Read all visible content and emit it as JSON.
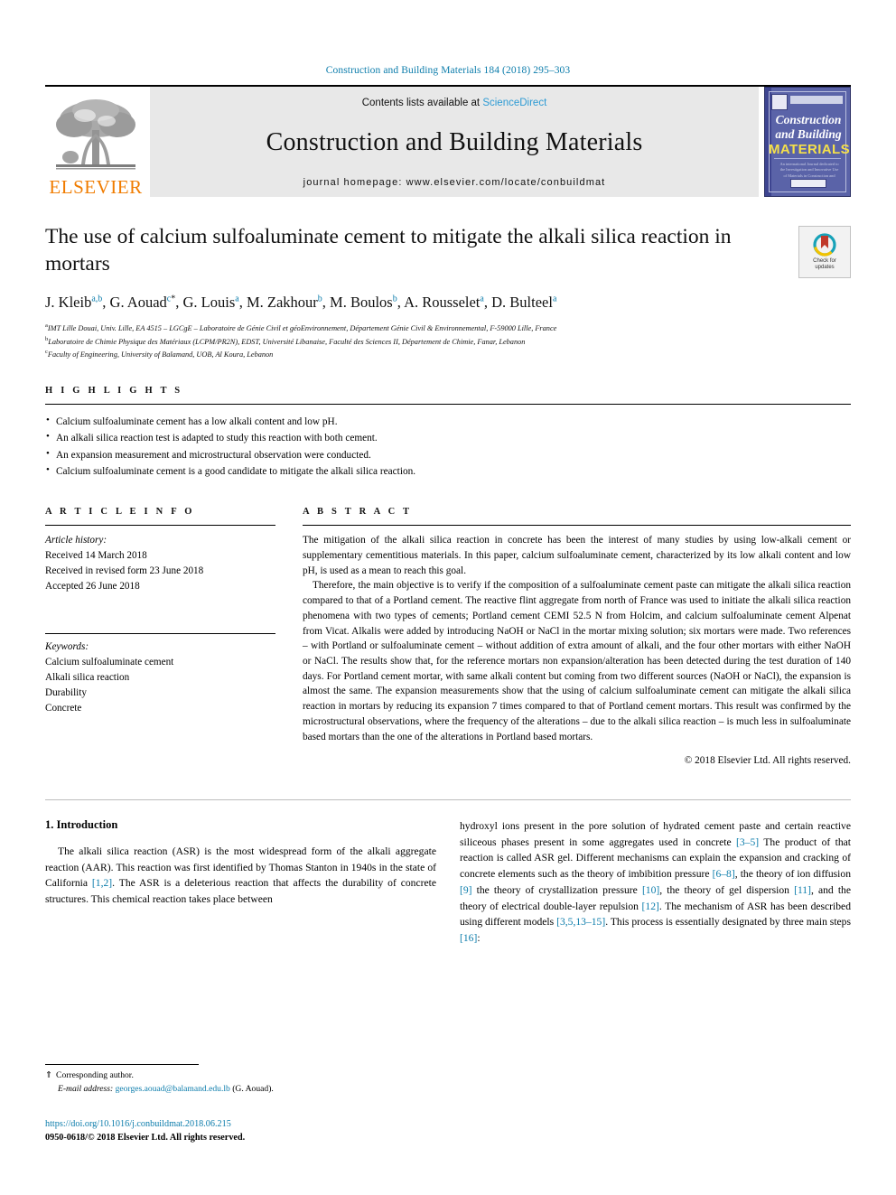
{
  "running_head": "Construction and Building Materials 184 (2018) 295–303",
  "masthead": {
    "publisher_name": "ELSEVIER",
    "contents_prefix": "Contents lists available at ",
    "contents_link": "ScienceDirect",
    "journal_title": "Construction and Building Materials",
    "homepage_line": "journal homepage: www.elsevier.com/locate/conbuildmat",
    "cover": {
      "line1": "Construction",
      "line2": "and Building",
      "line3": "MATERIALS",
      "blurb": "An international Journal dedicated to the Investigation and Innovative Use of Materials in Construction and Repair"
    }
  },
  "article": {
    "title": "The use of calcium sulfoaluminate cement to mitigate the alkali silica reaction in mortars",
    "crossmark_line1": "Check for",
    "crossmark_line2": "updates",
    "authors": [
      {
        "name": "J. Kleib",
        "sup": "a,b",
        "star": false
      },
      {
        "name": "G. Aouad",
        "sup": "c",
        "star": true
      },
      {
        "name": "G. Louis",
        "sup": "a",
        "star": false
      },
      {
        "name": "M. Zakhour",
        "sup": "b",
        "star": false
      },
      {
        "name": "M. Boulos",
        "sup": "b",
        "star": false
      },
      {
        "name": "A. Rousselet",
        "sup": "a",
        "star": false
      },
      {
        "name": "D. Bulteel",
        "sup": "a",
        "star": false
      }
    ],
    "affiliations": [
      {
        "marker": "a",
        "text": "IMT Lille Douai, Univ. Lille, EA 4515 – LGCgE – Laboratoire de Génie Civil et géoEnvironnement, Département Génie Civil & Environnemental, F-59000 Lille, France"
      },
      {
        "marker": "b",
        "text": "Laboratoire de Chimie Physique des Matériaux (LCPM/PR2N), EDST, Université Libanaise, Faculté des Sciences II, Département de Chimie, Fanar, Lebanon"
      },
      {
        "marker": "c",
        "text": "Faculty of Engineering, University of Balamand, UOB, Al Koura, Lebanon"
      }
    ]
  },
  "highlights": {
    "heading": "H I G H L I G H T S",
    "items": [
      "Calcium sulfoaluminate cement has a low alkali content and low pH.",
      "An alkali silica reaction test is adapted to study this reaction with both cement.",
      "An expansion measurement and microstructural observation were conducted.",
      "Calcium sulfoaluminate cement is a good candidate to mitigate the alkali silica reaction."
    ]
  },
  "article_info": {
    "heading": "A R T I C L E   I N F O",
    "history_label": "Article history:",
    "history": [
      "Received 14 March 2018",
      "Received in revised form 23 June 2018",
      "Accepted 26 June 2018"
    ],
    "keywords_label": "Keywords:",
    "keywords": [
      "Calcium sulfoaluminate cement",
      "Alkali silica reaction",
      "Durability",
      "Concrete"
    ]
  },
  "abstract": {
    "heading": "A B S T R A C T",
    "paragraph1": "The mitigation of the alkali silica reaction in concrete has been the interest of many studies by using low-alkali cement or supplementary cementitious materials. In this paper, calcium sulfoaluminate cement, characterized by its low alkali content and low pH, is used as a mean to reach this goal.",
    "paragraph2": "Therefore, the main objective is to verify if the composition of a sulfoaluminate cement paste can mitigate the alkali silica reaction compared to that of a Portland cement. The reactive flint aggregate from north of France was used to initiate the alkali silica reaction phenomena with two types of cements; Portland cement CEMI 52.5 N from Holcim, and calcium sulfoaluminate cement Alpenat from Vicat. Alkalis were added by introducing NaOH or NaCl in the mortar mixing solution; six mortars were made. Two references – with Portland or sulfoaluminate cement – without addition of extra amount of alkali, and the four other mortars with either NaOH or NaCl. The results show that, for the reference mortars non expansion/alteration has been detected during the test duration of 140 days. For Portland cement mortar, with same alkali content but coming from two different sources (NaOH or NaCl), the expansion is almost the same. The expansion measurements show that the using of calcium sulfoaluminate cement can mitigate the alkali silica reaction in mortars by reducing its expansion 7 times compared to that of Portland cement mortars. This result was confirmed by the microstructural observations, where the frequency of the alterations – due to the alkali silica reaction – is much less in sulfoaluminate based mortars than the one of the alterations in Portland based mortars.",
    "copyright": "© 2018 Elsevier Ltd. All rights reserved."
  },
  "introduction": {
    "number_title": "1. Introduction",
    "left_segments": [
      {
        "t": "The alkali silica reaction (ASR) is the most widespread form of the alkali aggregate reaction (AAR). This reaction was first identified by Thomas Stanton in 1940s in the state of California ",
        "ref": false
      },
      {
        "t": "[1,2]",
        "ref": true
      },
      {
        "t": ". The ASR is a deleterious reaction that affects the durability of concrete structures. This chemical reaction takes place between",
        "ref": false
      }
    ],
    "right_segments": [
      {
        "t": "hydroxyl ions present in the pore solution of hydrated cement paste and certain reactive siliceous phases present in some aggregates used in concrete ",
        "ref": false
      },
      {
        "t": "[3–5]",
        "ref": true
      },
      {
        "t": " The product of that reaction is called ASR gel. Different mechanisms can explain the expansion and cracking of concrete elements such as the theory of imbibition pressure ",
        "ref": false
      },
      {
        "t": "[6–8]",
        "ref": true
      },
      {
        "t": ", the theory of ion diffusion ",
        "ref": false
      },
      {
        "t": "[9]",
        "ref": true
      },
      {
        "t": " the theory of crystallization pressure ",
        "ref": false
      },
      {
        "t": "[10]",
        "ref": true
      },
      {
        "t": ", the theory of gel dispersion ",
        "ref": false
      },
      {
        "t": "[11]",
        "ref": true
      },
      {
        "t": ", and the theory of electrical double-layer repulsion ",
        "ref": false
      },
      {
        "t": "[12]",
        "ref": true
      },
      {
        "t": ". The mechanism of ASR has been described using different models ",
        "ref": false
      },
      {
        "t": "[3,5,13–15]",
        "ref": true
      },
      {
        "t": ". This process is essentially designated by three main steps ",
        "ref": false
      },
      {
        "t": "[16]",
        "ref": true
      },
      {
        "t": ":",
        "ref": false
      }
    ]
  },
  "footer": {
    "corresponding_marker": "⇑",
    "corresponding_text": "Corresponding author.",
    "email_label": "E-mail address:",
    "email": "georges.aouad@balamand.edu.lb",
    "email_suffix": "(G. Aouad).",
    "doi": "https://doi.org/10.1016/j.conbuildmat.2018.06.215",
    "issn_line": "0950-0618/© 2018 Elsevier Ltd. All rights reserved."
  },
  "colors": {
    "link_blue": "#0b7cab",
    "sciencedirect_blue": "#2d9bd4",
    "elsevier_orange": "#f07c00",
    "cover_blue": "#5a63a8",
    "cover_yellow": "#f5e04a"
  }
}
